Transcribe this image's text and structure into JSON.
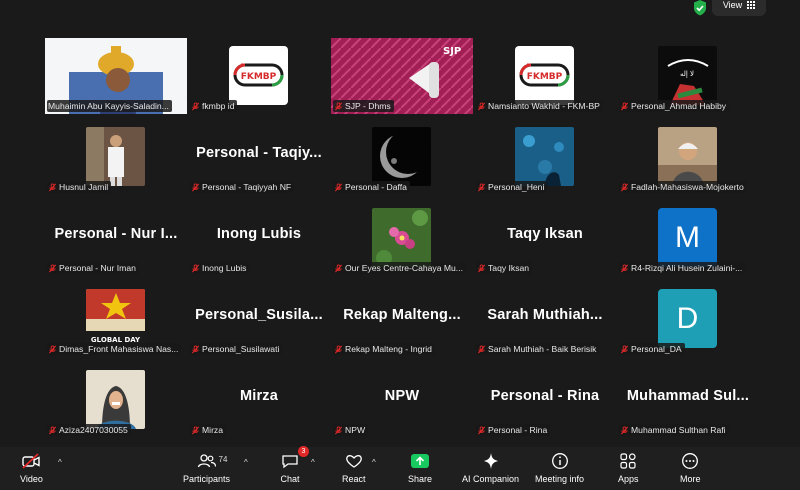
{
  "topbar": {
    "view_label": "View"
  },
  "tiles": [
    {
      "label": "Muhaimin Abu Kayyis-Saladin...",
      "active": true,
      "muted": false
    },
    {
      "label": "fkmbp id",
      "muted": true,
      "logo_text": "FKMBP"
    },
    {
      "label": "SJP - Dhms",
      "muted": true,
      "banner_text": "SJP"
    },
    {
      "label": "Namsianto Wakhid - FKM-BP",
      "muted": true,
      "logo_text": "FKMBP"
    },
    {
      "label": "Personal_Ahmad Habiby",
      "muted": true
    },
    {
      "label": "Husnul Jamil",
      "muted": true
    },
    {
      "label": "Personal - Taqiyyah NF",
      "muted": true,
      "display_name": "Personal - Taqiy..."
    },
    {
      "label": "Personal - Daffa",
      "muted": true
    },
    {
      "label": "Personal_Heni",
      "muted": true
    },
    {
      "label": "Fadlah-Mahasiswa-Mojokerto",
      "muted": true
    },
    {
      "label": "Personal - Nur Iman",
      "muted": true,
      "display_name": "Personal - Nur I..."
    },
    {
      "label": "Inong Lubis",
      "muted": true,
      "display_name": "Inong Lubis"
    },
    {
      "label": "Our Eyes Centre-Cahaya Mu...",
      "muted": true
    },
    {
      "label": "Taqy Iksan",
      "muted": true,
      "display_name": "Taqy Iksan"
    },
    {
      "label": "R4-Rizqi Ali Husein Zulaini-...",
      "muted": true,
      "letter": "M",
      "color": "#0e72c9"
    },
    {
      "label": "Dimas_Front Mahasiswa Nas...",
      "muted": true,
      "poster_text": "GLOBAL DAY"
    },
    {
      "label": "Personal_Susilawati",
      "muted": true,
      "display_name": "Personal_Susila..."
    },
    {
      "label": "Rekap Malteng - Ingrid",
      "muted": true,
      "display_name": "Rekap Malteng..."
    },
    {
      "label": "Sarah Muthiah - Baik Berisik",
      "muted": true,
      "display_name": "Sarah Muthiah..."
    },
    {
      "label": "Personal_DA",
      "muted": true,
      "letter": "D",
      "color": "#1e9fb5"
    },
    {
      "label": "Aziza2407030055",
      "muted": true
    },
    {
      "label": "Mirza",
      "muted": true,
      "display_name": "Mirza"
    },
    {
      "label": "NPW",
      "muted": true,
      "display_name": "NPW"
    },
    {
      "label": "Personal - Rina",
      "muted": true,
      "display_name": "Personal - Rina"
    },
    {
      "label": "Muhammad Sulthan Rafi",
      "muted": true,
      "display_name": "Muhammad Sul..."
    }
  ],
  "toolbar": {
    "video": "Video",
    "participants": "Participants",
    "participants_count": "74",
    "chat": "Chat",
    "chat_badge": "3",
    "react": "React",
    "share": "Share",
    "ai_companion": "AI Companion",
    "meeting_info": "Meeting info",
    "apps": "Apps",
    "more": "More"
  },
  "colors": {
    "accent_green": "#23d959",
    "share_green": "#17c95f",
    "mute_red": "#e02828"
  }
}
